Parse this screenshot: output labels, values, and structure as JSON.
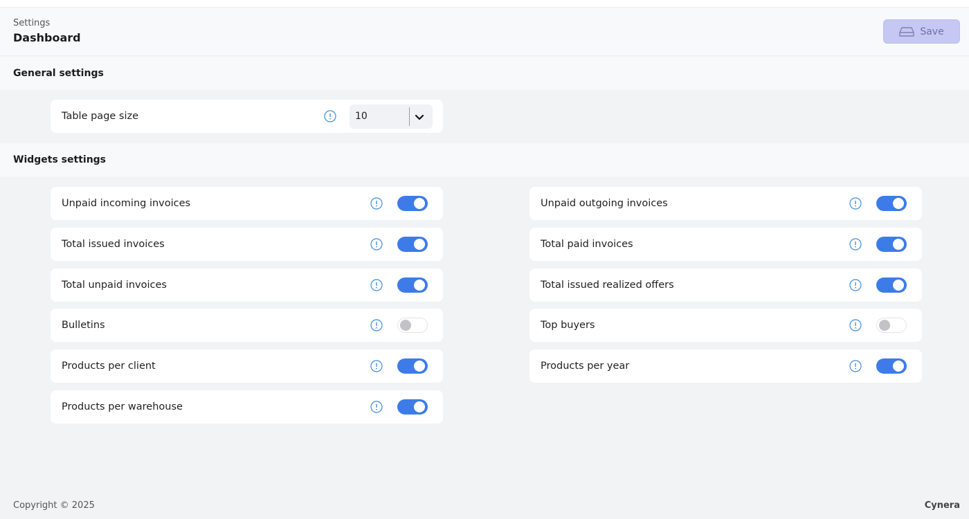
{
  "header": {
    "breadcrumb": "Settings",
    "title": "Dashboard",
    "save_label": "Save"
  },
  "general": {
    "title": "General settings",
    "page_size": {
      "label": "Table page size",
      "value": "10"
    }
  },
  "widgets": {
    "title": "Widgets settings",
    "left": [
      {
        "label": "Unpaid incoming invoices",
        "enabled": true
      },
      {
        "label": "Total issued invoices",
        "enabled": true
      },
      {
        "label": "Total unpaid invoices",
        "enabled": true
      },
      {
        "label": "Bulletins",
        "enabled": false
      },
      {
        "label": "Products per client",
        "enabled": true
      },
      {
        "label": "Products per warehouse",
        "enabled": true
      }
    ],
    "right": [
      {
        "label": "Unpaid outgoing invoices",
        "enabled": true
      },
      {
        "label": "Total paid invoices",
        "enabled": true
      },
      {
        "label": "Total issued realized offers",
        "enabled": true
      },
      {
        "label": "Top buyers",
        "enabled": false
      },
      {
        "label": "Products per year",
        "enabled": true
      }
    ]
  },
  "footer": {
    "copyright": "Copyright © 2025",
    "brand": "Cynera"
  },
  "colors": {
    "accent": "#3d7ce8",
    "save_button": "#c6c8f3"
  },
  "icons": {
    "info": "info-circle-icon",
    "save": "hard-drive-icon",
    "dropdown": "chevron-down-icon"
  }
}
